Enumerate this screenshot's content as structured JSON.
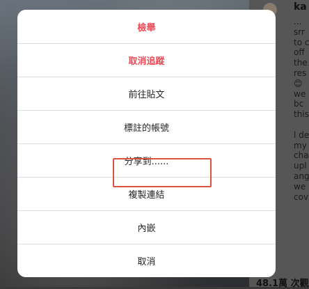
{
  "background": {
    "profile": {
      "username": "ka",
      "stats": "48.1萬 次觀"
    },
    "caption_fragments": [
      "...",
      "srr",
      "to c",
      "off",
      "the",
      "res",
      "😊",
      "we",
      "bc",
      "this",
      "",
      "l de",
      "my",
      "cha",
      "upl",
      "ang",
      "we",
      "cov"
    ]
  },
  "sheet": {
    "items": [
      {
        "label": "檢舉",
        "style": "danger"
      },
      {
        "label": "取消追蹤",
        "style": "danger"
      },
      {
        "label": "前往貼文",
        "style": "normal"
      },
      {
        "label": "標註的帳號",
        "style": "normal"
      },
      {
        "label": "分享到......",
        "style": "normal"
      },
      {
        "label": "複製連結",
        "style": "normal"
      },
      {
        "label": "內嵌",
        "style": "normal"
      },
      {
        "label": "取消",
        "style": "normal"
      }
    ],
    "highlight_color": "#d9533f",
    "danger_color": "#ed4956"
  }
}
